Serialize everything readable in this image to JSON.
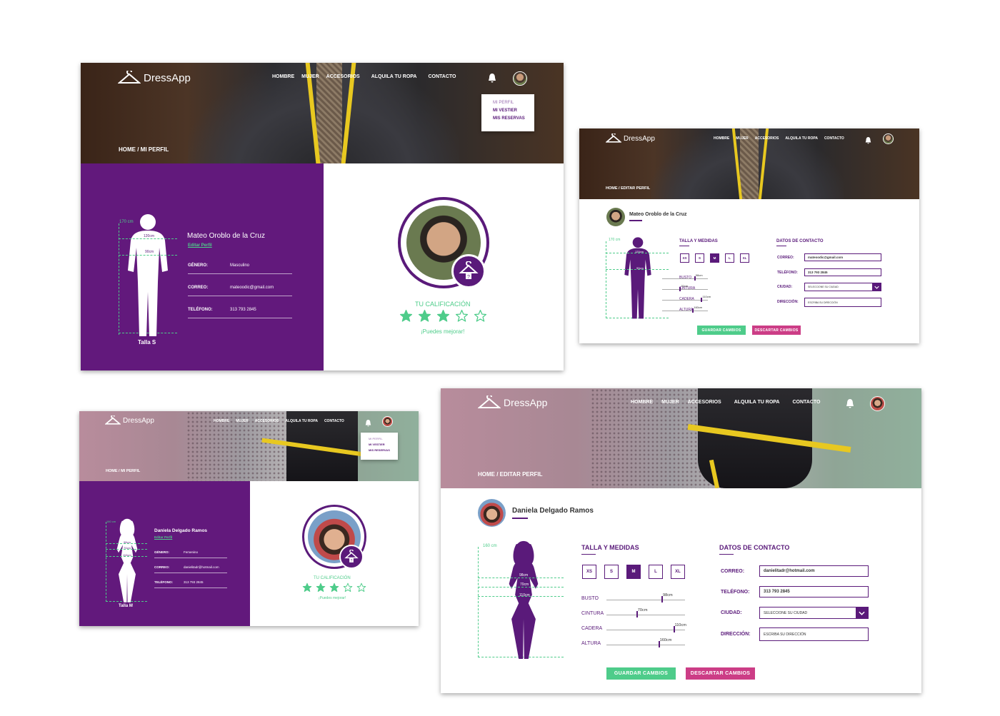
{
  "brand": {
    "name": "DressApp"
  },
  "nav": {
    "items": [
      "HOMBRE",
      "MUJER",
      "ACCESORIOS",
      "ALQUILA TU ROPA",
      "CONTACTO"
    ]
  },
  "menu": {
    "items": [
      "MI PERFIL",
      "MI VESTIER",
      "MIS RESERVAS"
    ]
  },
  "colors": {
    "purple": "#62197c",
    "green": "#4ecc8a",
    "pink": "#cc3d86"
  },
  "icons": [
    "hanger-icon",
    "bell-icon",
    "star-icon",
    "chevron-down-icon",
    "hanger-badge-icon"
  ],
  "profile_view_man": {
    "breadcrumb": "HOME / MI PERFIL",
    "name": "Mateo Oroblo de la Cruz",
    "edit_link": "Editar Perfil",
    "height": "170 cm",
    "measure_top": "120cm",
    "measure_mid": "90cm",
    "size_label": "Talla S",
    "fields": [
      {
        "label": "GÉNERO:",
        "value": "Masculino"
      },
      {
        "label": "CORREO:",
        "value": "mateoodic@gmail.com"
      },
      {
        "label": "TELÉFONO:",
        "value": "313 793 2845"
      }
    ],
    "rating_title": "TU CALIFICACIÓN",
    "rating_value": 3,
    "rating_max": 5,
    "rating_note": "¡Puedes mejorar!"
  },
  "profile_edit_man": {
    "breadcrumb": "HOME / EDITAR PERFIL",
    "name": "Mateo Oroblo de la Cruz",
    "height": "170 cm",
    "measure_top": "120cm",
    "measure_mid": "90cm",
    "sizes_title": "TALLA Y MEDIDAS",
    "sizes": [
      "XS",
      "S",
      "M",
      "L",
      "XL"
    ],
    "selected_size": "M",
    "measures": [
      {
        "label": "BUSTO",
        "value": "98cm",
        "fraction": 0.7
      },
      {
        "label": "CINTURA",
        "value": "70cm",
        "fraction": 0.38
      },
      {
        "label": "CADERA",
        "value": "110cm",
        "fraction": 0.85
      },
      {
        "label": "ALTURA",
        "value": "160cm",
        "fraction": 0.66
      }
    ],
    "contact_title": "DATOS DE CONTACTO",
    "contact": [
      {
        "label": "CORREO:",
        "value": "mateoodic@gmail.com"
      },
      {
        "label": "TELÉFONO:",
        "value": "313 793 2845"
      },
      {
        "label": "CIUDAD:",
        "value": "SELECCIONE SU CIUDAD"
      },
      {
        "label": "DIRECCIÓN:",
        "value": "ESCRIBA SU DIRECCIÓN"
      }
    ],
    "save_label": "GUARDAR CAMBIOS",
    "discard_label": "DESCARTAR CAMBIOS"
  },
  "profile_view_woman": {
    "breadcrumb": "HOME / MI PERFIL",
    "name": "Daniela Delgado Ramos",
    "edit_link": "Editar Perfil",
    "height": "160 cm",
    "measure_top": "98cm",
    "measure_mid": "70cm",
    "measure_low": "110cm",
    "size_label": "Talla M",
    "fields": [
      {
        "label": "GÉNERO:",
        "value": "Femenino"
      },
      {
        "label": "CORREO:",
        "value": "danielitadr@hotmail.com"
      },
      {
        "label": "TELÉFONO:",
        "value": "313 793 2845"
      }
    ],
    "rating_title": "TU CALIFICACIÓN",
    "rating_value": 3,
    "rating_max": 5,
    "rating_note": "¡Puedes mejorar!"
  },
  "profile_edit_woman": {
    "breadcrumb": "HOME / EDITAR PERFIL",
    "name": "Daniela Delgado Ramos",
    "height": "160 cm",
    "measure_top": "98cm",
    "measure_mid": "70cm",
    "measure_low": "110cm",
    "sizes_title": "TALLA Y MEDIDAS",
    "sizes": [
      "XS",
      "S",
      "M",
      "L",
      "XL"
    ],
    "selected_size": "M",
    "measures": [
      {
        "label": "BUSTO",
        "value": "98cm",
        "fraction": 0.7
      },
      {
        "label": "CINTURA",
        "value": "70cm",
        "fraction": 0.38
      },
      {
        "label": "CADERA",
        "value": "110cm",
        "fraction": 0.85
      },
      {
        "label": "ALTURA",
        "value": "160cm",
        "fraction": 0.66
      }
    ],
    "contact_title": "DATOS DE CONTACTO",
    "contact": [
      {
        "label": "CORREO:",
        "value": "danielitadr@hotmail.com"
      },
      {
        "label": "TELÉFONO:",
        "value": "313 793 2845"
      },
      {
        "label": "CIUDAD:",
        "value": "SELECCIONE SU CIUDAD"
      },
      {
        "label": "DIRECCIÓN:",
        "value": "ESCRIBA SU DIRECCIÓN"
      }
    ],
    "save_label": "GUARDAR CAMBIOS",
    "discard_label": "DESCARTAR CAMBIOS"
  }
}
